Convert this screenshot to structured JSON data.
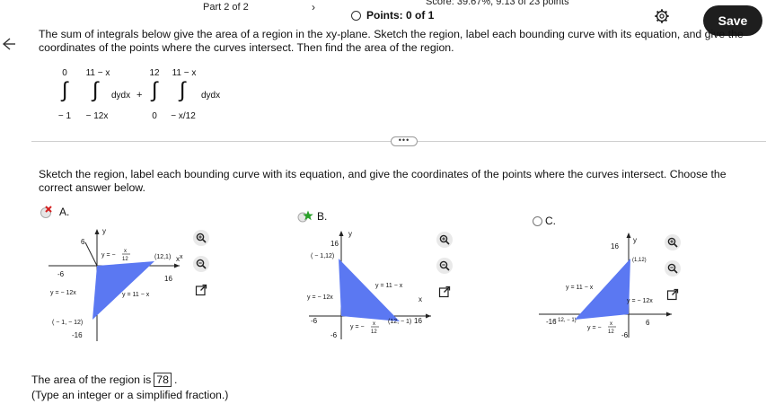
{
  "header": {
    "part": "Part 2 of 2",
    "score": "Score: 39.67%, 9.13 of 23 points",
    "points": "Points: 0 of 1",
    "save_label": "Save"
  },
  "question": {
    "prompt": "The sum of integrals below give the area of a region in the xy-plane. Sketch the region, label each bounding curve with its equation, and give the coordinates of the points where the curves intersect. Then find the area of the region.",
    "integral1": {
      "lower": "− 1",
      "upper": "0",
      "inner_lower": "− 12x",
      "inner_upper": "11 − x",
      "integrand": "dydx"
    },
    "plus": "+",
    "integral2": {
      "lower": "0",
      "upper": "12",
      "inner_lower": "− x/12",
      "inner_upper": "11 − x",
      "integrand": "dydx"
    },
    "more": "•••",
    "instruction": "Sketch the region, label each bounding curve with its equation, and give the coordinates of the points where the curves intersect. Choose the correct answer below."
  },
  "options": [
    {
      "label": "A.",
      "status": "incorrect",
      "graph": {
        "y_axis": "y",
        "x_axis": "x",
        "ticks": {
          "y_top": "6",
          "x_left": "-6",
          "x_right": "16",
          "y_bottom": "-16"
        },
        "labels": {
          "curve_top": "y = −",
          "curve_top_frac_num": "x",
          "curve_top_frac_den": "12",
          "curve_left": "y = − 12x",
          "curve_right": "y = 11 − x",
          "point_right": "(12,1)",
          "point_bottom": "( − 1, − 12)"
        }
      }
    },
    {
      "label": "B.",
      "status": "selected",
      "graph": {
        "y_axis": "y",
        "x_axis": "x",
        "ticks": {
          "y_top": "16",
          "x_left": "-6",
          "x_right": "16",
          "y_bottom": "-6"
        },
        "labels": {
          "curve_bottom": "y = −",
          "curve_bottom_frac_num": "x",
          "curve_bottom_frac_den": "12",
          "curve_left": "y = − 12x",
          "curve_right": "y = 11 − x",
          "point_top": "( − 1,12)",
          "point_right": "(12, − 1)"
        }
      }
    },
    {
      "label": "C.",
      "status": "unselected",
      "graph": {
        "y_axis": "y",
        "ticks": {
          "y_top": "16",
          "x_left": "-16",
          "x_right": "6",
          "y_bottom": "-6"
        },
        "labels": {
          "curve_bottom": "y = −",
          "curve_bottom_frac_num": "x",
          "curve_bottom_frac_den": "12",
          "curve_left": "y = 11 − x",
          "curve_right": "y = − 12x",
          "point_top": "(1,12)",
          "point_left": "− 12, − 1)"
        }
      }
    }
  ],
  "answer": {
    "prefix": "The area of the region is",
    "value": "78",
    "suffix": ".",
    "hint": "(Type an integer or a simplified fraction.)"
  },
  "colors": {
    "region": "#5b78f2",
    "correct": "#2aa02a",
    "incorrect": "#d42020",
    "save_bg": "#1e1e1e"
  }
}
